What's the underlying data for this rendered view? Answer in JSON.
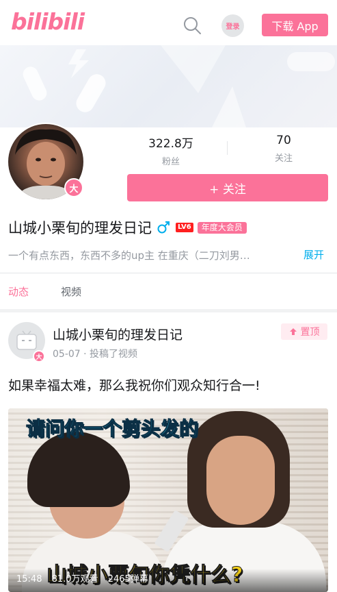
{
  "header": {
    "logo": "bilibili",
    "login_label": "登录",
    "download_label": "下载 App"
  },
  "profile": {
    "avatar_badge": "大",
    "followers_value": "322.8万",
    "followers_label": "粉丝",
    "following_value": "70",
    "following_label": "关注",
    "follow_button": "+ 关注",
    "name": "山城小栗旬的理发日记",
    "level": "LV6",
    "vip_label": "年度大会员",
    "sign": "一个有点东西，东西不多的up主 在重庆（二刀刘男…",
    "expand_label": "展开"
  },
  "tabs": [
    {
      "label": "动态",
      "active": true
    },
    {
      "label": "视频",
      "active": false
    }
  ],
  "post": {
    "author": "山城小栗旬的理发日记",
    "avatar_badge": "大",
    "date": "05-07",
    "action": "投稿了视频",
    "pin_label": "置顶",
    "text": "如果幸福太难，那么我祝你们观众知行合一!",
    "video": {
      "caption_top": "请问你一个剪头发的",
      "caption_bottom": "山城小栗旬你凭什么?",
      "duration": "15:48",
      "views": "81.0万观看",
      "danmaku": "2465弹幕"
    }
  },
  "colors": {
    "brand_pink": "#fb7299",
    "link_blue": "#00aeec",
    "text_gray": "#9499a0"
  }
}
